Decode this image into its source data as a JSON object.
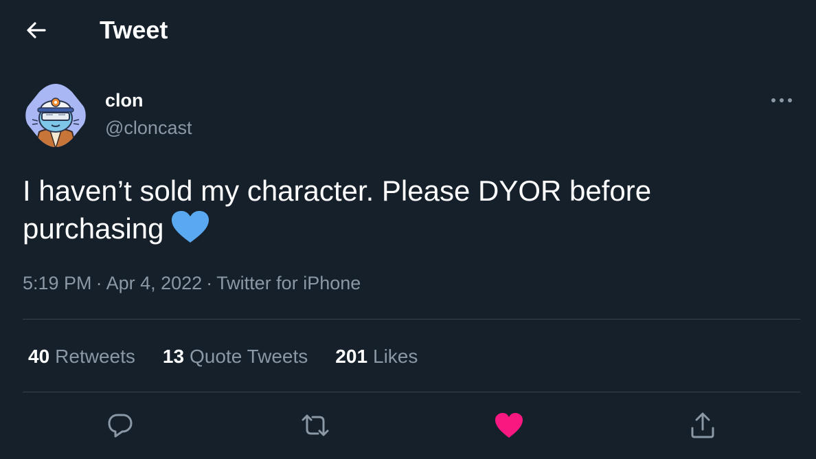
{
  "header": {
    "title": "Tweet",
    "back_icon": "arrow-left-icon"
  },
  "author": {
    "display_name": "clon",
    "handle": "@cloncast",
    "more_icon": "more-icon"
  },
  "tweet": {
    "text": "I haven’t sold my character. Please DYOR before purchasing",
    "emoji": "blue-heart-emoji",
    "time": "5:19 PM",
    "date": "Apr 4, 2022",
    "source": "Twitter for iPhone",
    "separator": "·"
  },
  "stats": {
    "retweets_count": "40",
    "retweets_label": "Retweets",
    "quotes_count": "13",
    "quotes_label": "Quote Tweets",
    "likes_count": "201",
    "likes_label": "Likes"
  },
  "actions": [
    {
      "name": "reply-icon"
    },
    {
      "name": "retweet-icon"
    },
    {
      "name": "like-icon",
      "active": true,
      "color": "#f91880"
    },
    {
      "name": "share-icon"
    }
  ],
  "colors": {
    "background": "#15202b",
    "text_primary": "#ffffff",
    "text_secondary": "#8b98a5",
    "divider": "#38444d",
    "like_active": "#f91880",
    "emoji_heart": "#5aa9f0"
  }
}
